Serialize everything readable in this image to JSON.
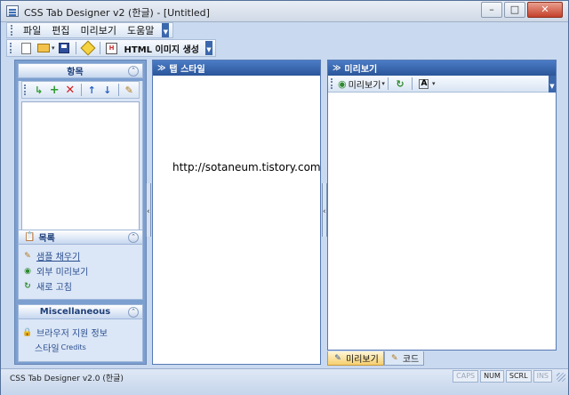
{
  "window": {
    "title": "CSS Tab Designer v2 (한글) - [Untitled]"
  },
  "menu": {
    "items": [
      "파일",
      "편집",
      "미리보기",
      "도움말"
    ]
  },
  "toolbar": {
    "generate_html_label": "HTML 이미지 생성"
  },
  "sidebar": {
    "items_group": {
      "title": "항목"
    },
    "list_group": {
      "title": "목록",
      "links": [
        "샘플 채우기",
        "외부 미리보기",
        "새로 고침"
      ]
    },
    "misc_group": {
      "title": "Miscellaneous",
      "browser_info": "브라우저 지원 정보",
      "style_label": "스타일",
      "credits_label": "Credits"
    }
  },
  "tab_style_pane": {
    "title": "탭 스타일",
    "url": "http://sotaneum.tistory.com"
  },
  "preview_pane": {
    "title": "미리보기",
    "preview_button": "미리보기"
  },
  "bottom_tabs": [
    "미리보기",
    "코드"
  ],
  "statusbar": {
    "text": "CSS Tab Designer v2.0 (한글)",
    "panels": [
      "CAPS",
      "NUM",
      "SCRL",
      "INS"
    ]
  },
  "colors": {
    "accent": "#2a5599",
    "panel_bg": "#7c9fd0",
    "window_bg": "#c9d9ef"
  }
}
